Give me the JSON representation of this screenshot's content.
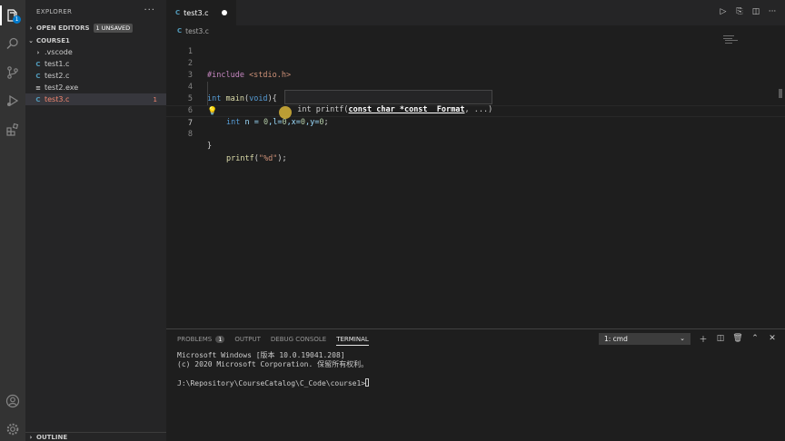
{
  "activity_bar": {
    "explorer_badge": "1"
  },
  "sidebar": {
    "title": "EXPLORER",
    "more": "···",
    "open_editors": {
      "label": "OPEN EDITORS",
      "badge": "1 UNSAVED"
    },
    "folder": {
      "label": "COURSE1"
    },
    "files": [
      {
        "icon": "›",
        "name": ".vscode"
      },
      {
        "icon": "C",
        "name": "test1.c"
      },
      {
        "icon": "C",
        "name": "test2.c"
      },
      {
        "icon": "≡",
        "name": "test2.exe"
      },
      {
        "icon": "C",
        "name": "test3.c",
        "problems": "1"
      }
    ],
    "outline": "OUTLINE"
  },
  "editor": {
    "tab": {
      "icon": "C",
      "label": "test3.c"
    },
    "breadcrumb": {
      "icon": "C",
      "label": "test3.c"
    },
    "line_numbers": [
      "1",
      "2",
      "3",
      "4",
      "5",
      "6",
      "7",
      "8"
    ],
    "lines": {
      "l2_pre": "#include ",
      "l2_inc": "<stdio.h>",
      "l4_type": "int",
      "l4_fn": " main",
      "l4_paren": "(",
      "l4_void": "void",
      "l4_close": "){",
      "l5_type": "int",
      "l5_rest_a": " n = ",
      "l5_num1": "0",
      "l5_rest_b": ",l=",
      "l5_num2": "0",
      "l5_rest_c": ",x=",
      "l5_num3": "0",
      "l5_rest_d": ",y=",
      "l5_num4": "0",
      "l5_rest_e": ";",
      "l7_fn": "printf",
      "l7_open": "(",
      "l7_str": "\"%d\"",
      "l7_close": ");",
      "l8": "}"
    },
    "signature_hint": {
      "prefix": "int printf(",
      "active_param": "const char *const _Format",
      "suffix": ", ...)"
    }
  },
  "panel": {
    "tabs": [
      {
        "label": "PROBLEMS",
        "count": "1"
      },
      {
        "label": "OUTPUT"
      },
      {
        "label": "DEBUG CONSOLE"
      },
      {
        "label": "TERMINAL"
      }
    ],
    "terminal_select": "1: cmd",
    "terminal_lines": [
      "Microsoft Windows [版本 10.0.19041.208]",
      "(c) 2020 Microsoft Corporation. 保留所有权利。",
      "",
      "J:\\Repository\\CourseCatalog\\C_Code\\course1>"
    ]
  }
}
